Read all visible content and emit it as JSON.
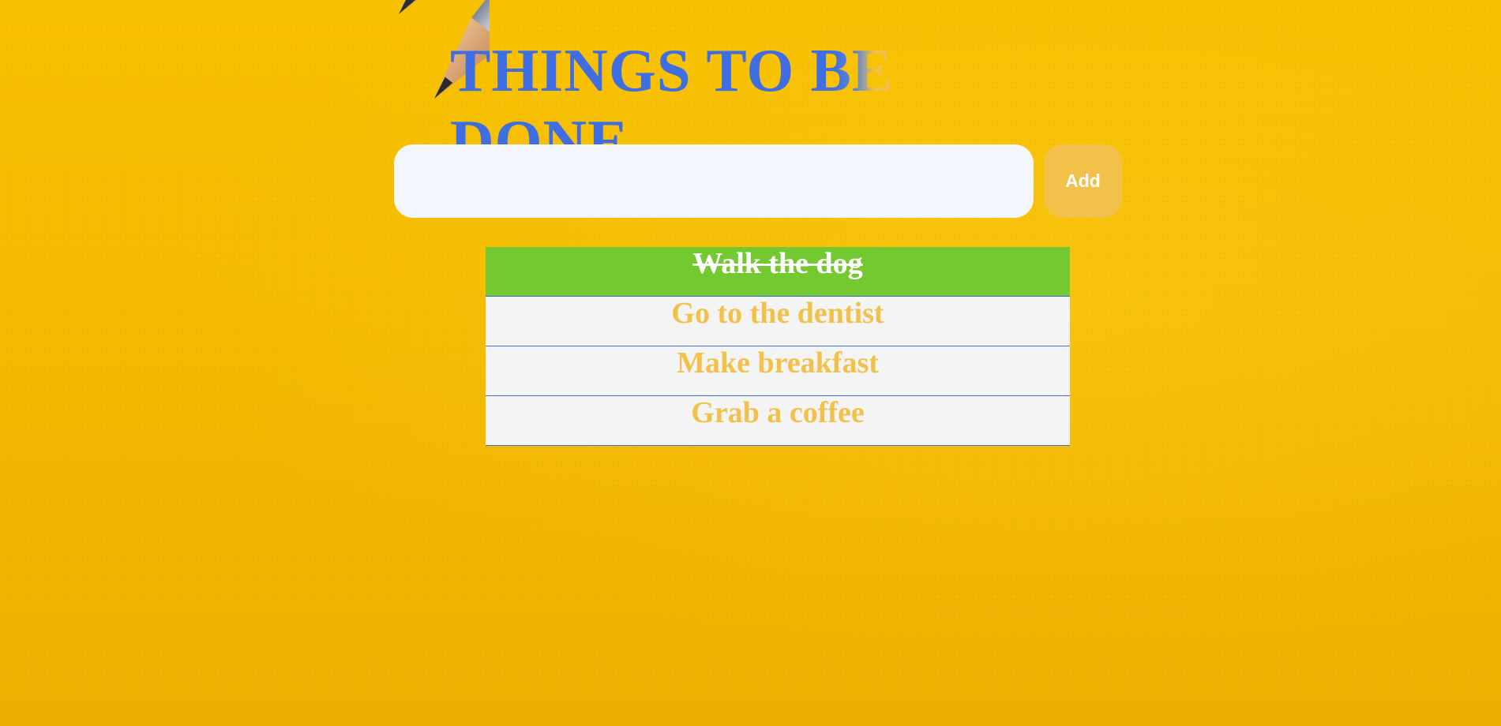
{
  "header": {
    "title": "THINGS TO BE DONE"
  },
  "form": {
    "input_value": "",
    "input_placeholder": "",
    "add_label": "Add"
  },
  "tasks": [
    {
      "text": "Walk the dog",
      "done": true
    },
    {
      "text": "Go to the dentist",
      "done": false
    },
    {
      "text": "Make breakfast",
      "done": false
    },
    {
      "text": "Grab a coffee",
      "done": false
    }
  ],
  "colors": {
    "background": "#f6bd00",
    "title_primary": "#3f6ee3",
    "title_fade": "#f2c14a",
    "accent": "#f2c14a",
    "done": "#73c92f",
    "item_bg": "#f4f4f4",
    "divider": "#3f6ee3"
  },
  "decor": {
    "background_image": "pencils-on-yellow-paper"
  }
}
